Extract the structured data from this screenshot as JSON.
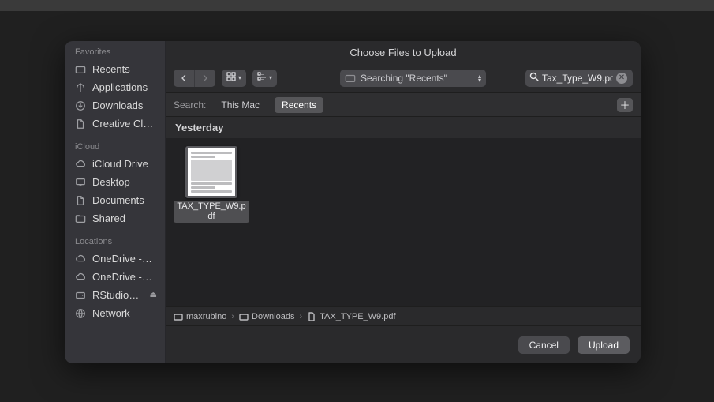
{
  "title": "Choose Files to Upload",
  "sidebar": {
    "sections": [
      {
        "title": "Favorites",
        "items": [
          "Recents",
          "Applications",
          "Downloads",
          "Creative Cl…"
        ]
      },
      {
        "title": "iCloud",
        "items": [
          "iCloud Drive",
          "Desktop",
          "Documents",
          "Shared"
        ]
      },
      {
        "title": "Locations",
        "items": [
          "OneDrive -…",
          "OneDrive -…",
          "RStudio…",
          "Network"
        ]
      }
    ]
  },
  "toolbar": {
    "location": "Searching \"Recents\"",
    "search_value": "Tax_Type_W9.pd"
  },
  "scope": {
    "label": "Search:",
    "options": [
      "This Mac",
      "Recents"
    ],
    "active_index": 1
  },
  "content": {
    "groups": [
      {
        "title": "Yesterday",
        "files": [
          {
            "name": "TAX_TYPE_W9.pdf",
            "selected": true
          }
        ]
      }
    ]
  },
  "path": [
    "maxrubino",
    "Downloads",
    "TAX_TYPE_W9.pdf"
  ],
  "footer": {
    "cancel": "Cancel",
    "confirm": "Upload"
  }
}
